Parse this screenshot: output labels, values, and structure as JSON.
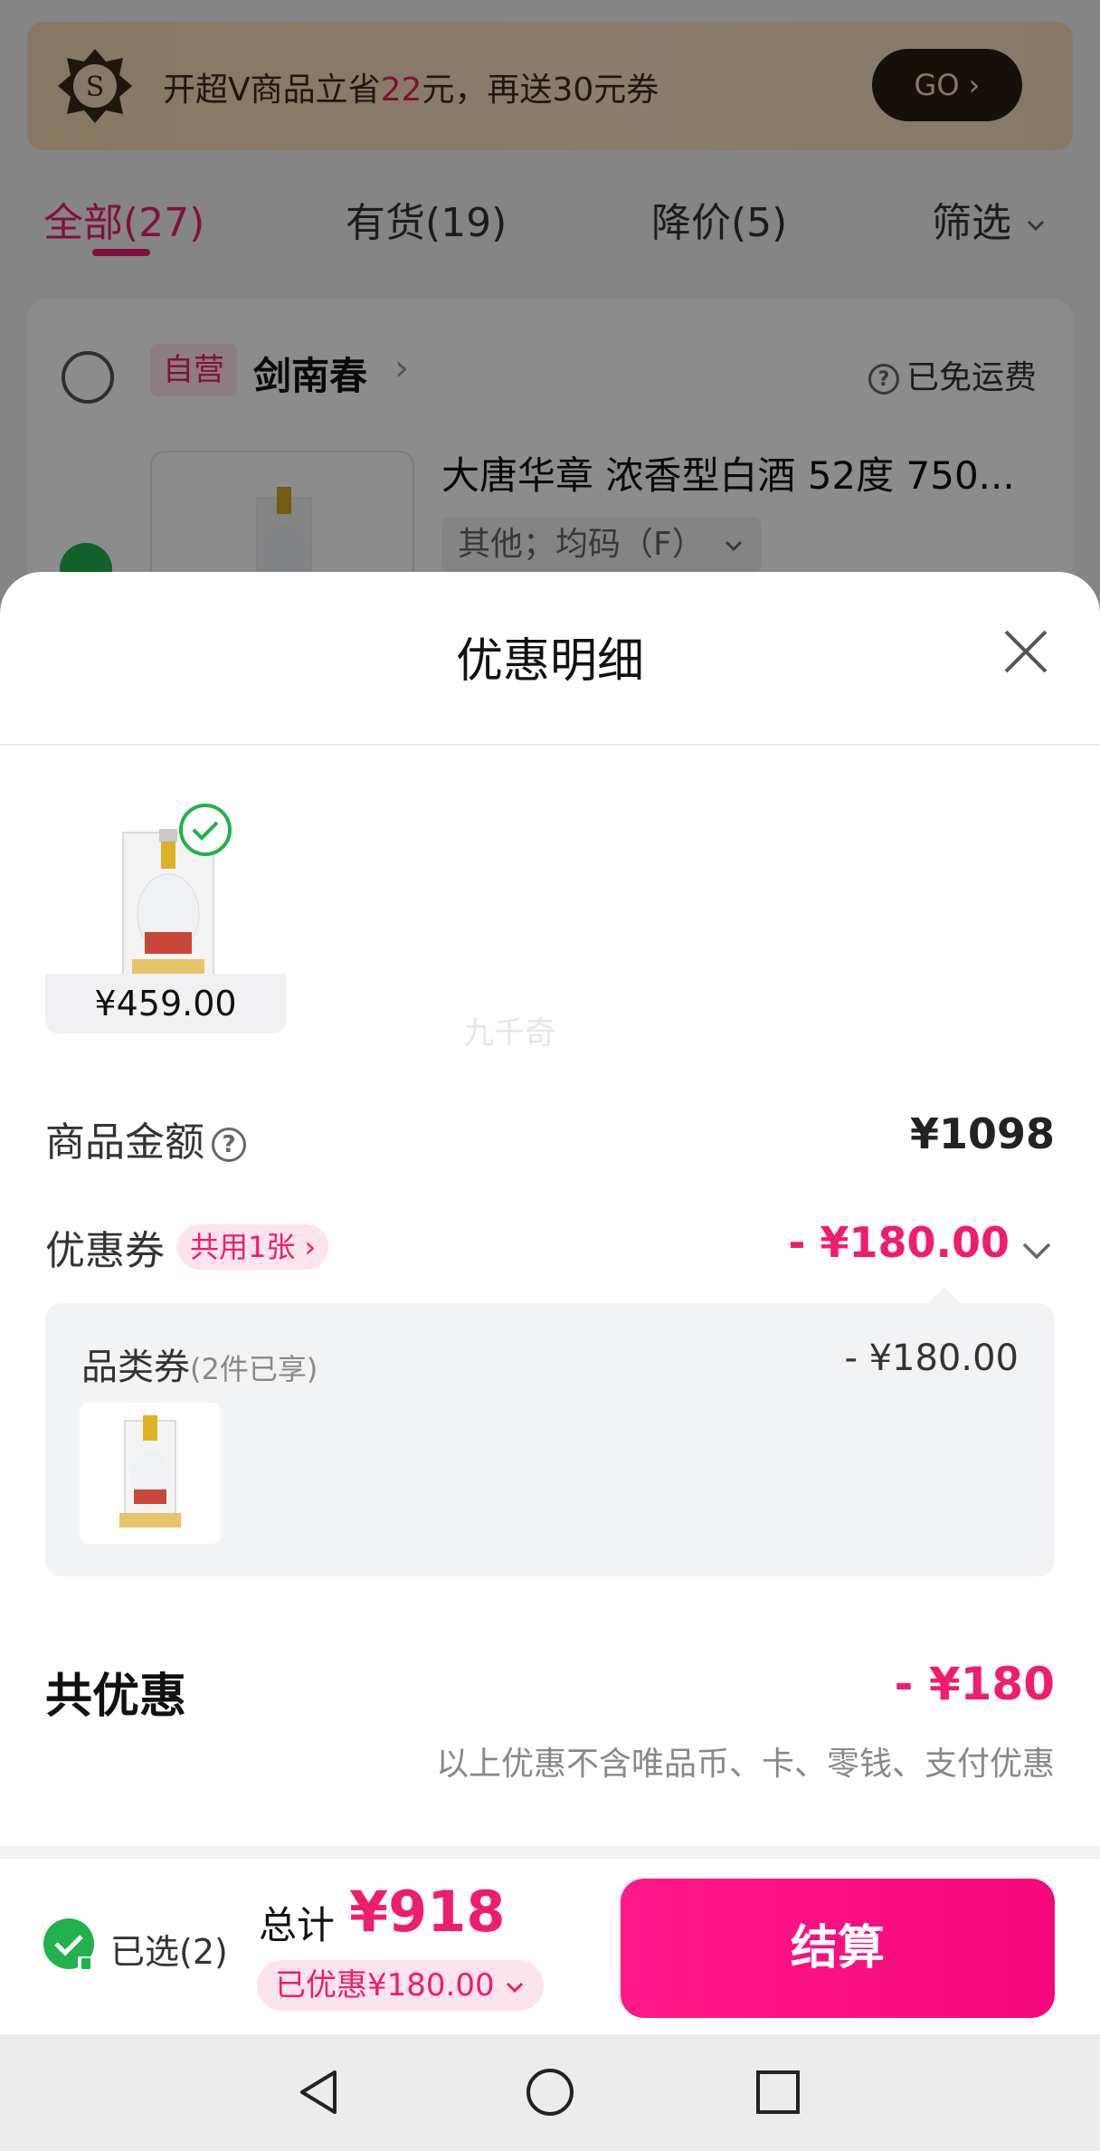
{
  "background": {
    "vip_banner": {
      "text_before": "开超V商品立省",
      "highlight": "22",
      "text_after": "元，再送30元券",
      "badge_letter": "S",
      "go_label": "GO ›"
    },
    "tabs": [
      {
        "label": "全部(27)"
      },
      {
        "label": "有货(19)"
      },
      {
        "label": "降价(5)"
      },
      {
        "label": "筛选"
      }
    ],
    "shop": {
      "tag": "自营",
      "name": "剑南春",
      "free_shipping": "已免运费"
    },
    "product": {
      "title": "大唐华章 浓香型白酒 52度 750...",
      "sku": "其他；均码（F）"
    }
  },
  "sheet": {
    "title": "优惠明细",
    "watermark": "九千奇",
    "item": {
      "price": "¥459.00"
    },
    "goods_amount": {
      "label": "商品金额",
      "value": "¥1098"
    },
    "coupon": {
      "label": "优惠券",
      "chip": "共用1张 ›",
      "value": "- ¥180.00"
    },
    "coupon_detail": {
      "name": "品类券",
      "sub": "(2件已享)",
      "value": "- ¥180.00"
    },
    "total_discount": {
      "label": "共优惠",
      "value": "- ¥180",
      "note": "以上优惠不含唯品币、卡、零钱、支付优惠"
    }
  },
  "bottom_bar": {
    "selected": "已选(2)",
    "total_label": "总计",
    "total_value": "¥918",
    "saved": "已优惠¥180.00",
    "checkout": "结算"
  },
  "colors": {
    "accent": "#ef1d6e",
    "checkout_gradient_start": "#ff1887",
    "success_green": "#22b14c"
  },
  "icons": [
    "vip-s-badge-icon",
    "chevron-right-icon",
    "chevron-down-icon",
    "help-circle-icon",
    "close-icon",
    "check-circle-icon",
    "lock-icon",
    "nav-back-icon",
    "nav-home-icon",
    "nav-recents-icon"
  ]
}
